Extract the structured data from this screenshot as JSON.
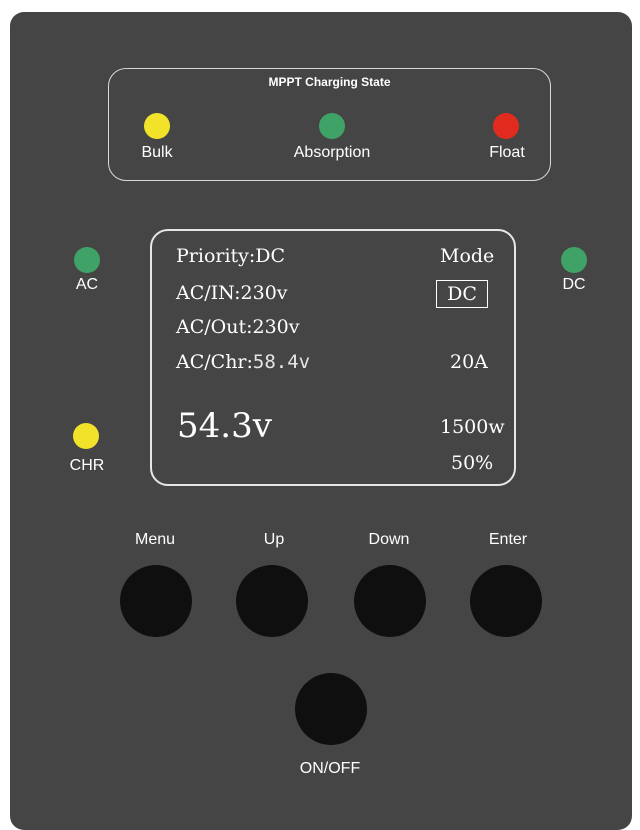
{
  "charging_state": {
    "title": "MPPT Charging State",
    "indicators": [
      {
        "label": "Bulk",
        "color": "#f2e32a"
      },
      {
        "label": "Absorption",
        "color": "#3fa267"
      },
      {
        "label": "Float",
        "color": "#e22b1f"
      }
    ]
  },
  "side_leds": {
    "ac": {
      "label": "AC",
      "color": "#3fa267"
    },
    "dc": {
      "label": "DC",
      "color": "#3fa267"
    },
    "chr": {
      "label": "CHR",
      "color": "#f2e32a"
    }
  },
  "display": {
    "priority": "Priority:DC",
    "mode_label": "Mode",
    "mode_value": "DC",
    "ac_in": "AC/IN:230v",
    "ac_out": "AC/Out:230v",
    "ac_chr_label": "AC/Chr:",
    "ac_chr_value": "58.4v",
    "current": "20A",
    "voltage": "54.3v",
    "power": "1500w",
    "percent": "50%"
  },
  "buttons": {
    "menu": "Menu",
    "up": "Up",
    "down": "Down",
    "enter": "Enter",
    "onoff": "ON/OFF"
  },
  "colors": {
    "panel": "#454545",
    "button": "#0f0f0f"
  }
}
